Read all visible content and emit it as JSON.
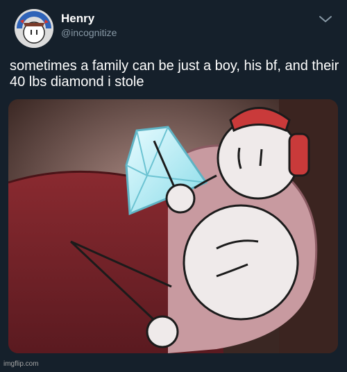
{
  "tweet": {
    "author": {
      "display_name": "Henry",
      "handle": "@incognitize",
      "avatar_icon": "avatar-icon"
    },
    "menu_icon": "chevron-down-icon",
    "text": "sometimes a family can be just a boy, his bf, and their 40 lbs diamond i stole",
    "media_description_icon": "meme-image"
  },
  "watermark": "imgflip.com",
  "colors": {
    "background": "#15202b",
    "handle": "#8899a6",
    "text": "#ffffff"
  }
}
